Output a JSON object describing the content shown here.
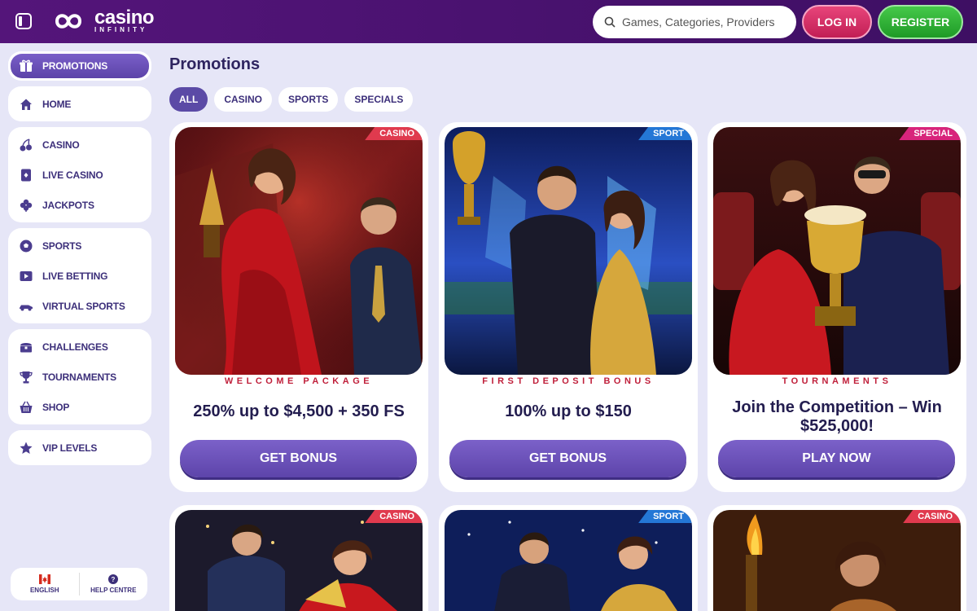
{
  "header": {
    "logo_big": "casino",
    "logo_small": "INFINITY",
    "search_placeholder": "Games, Categories, Providers",
    "login_label": "LOG IN",
    "register_label": "REGISTER"
  },
  "sidebar": {
    "groups": [
      [
        {
          "label": "PROMOTIONS",
          "icon": "gift-icon",
          "active": true
        }
      ],
      [
        {
          "label": "HOME",
          "icon": "home-icon"
        }
      ],
      [
        {
          "label": "CASINO",
          "icon": "cherries-icon"
        },
        {
          "label": "LIVE CASINO",
          "icon": "live-card-icon"
        },
        {
          "label": "JACKPOTS",
          "icon": "clover-icon"
        }
      ],
      [
        {
          "label": "SPORTS",
          "icon": "soccer-ball-icon"
        },
        {
          "label": "LIVE BETTING",
          "icon": "play-screen-icon"
        },
        {
          "label": "VIRTUAL SPORTS",
          "icon": "race-car-icon"
        }
      ],
      [
        {
          "label": "CHALLENGES",
          "icon": "treasure-chest-icon"
        },
        {
          "label": "TOURNAMENTS",
          "icon": "trophy-icon"
        },
        {
          "label": "SHOP",
          "icon": "basket-icon"
        }
      ],
      [
        {
          "label": "VIP LEVELS",
          "icon": "star-icon"
        }
      ]
    ],
    "footer": {
      "language": "ENGLISH",
      "help": "HELP CENTRE"
    }
  },
  "main": {
    "title": "Promotions",
    "filters": [
      "ALL",
      "CASINO",
      "SPORTS",
      "SPECIALS"
    ],
    "active_filter": "ALL",
    "cards": [
      {
        "tag": "CASINO",
        "tag_type": "casino",
        "subtitle": "WELCOME PACKAGE",
        "title": "250% up to $4,500 + 350 FS",
        "button": "GET BONUS",
        "scene": "red"
      },
      {
        "tag": "SPORT",
        "tag_type": "sport",
        "subtitle": "FIRST DEPOSIT BONUS",
        "title": "100% up to $150",
        "button": "GET BONUS",
        "scene": "blue"
      },
      {
        "tag": "SPECIAL",
        "tag_type": "special",
        "subtitle": "TOURNAMENTS",
        "title": "Join the Competition – Win $525,000!",
        "button": "PLAY NOW",
        "scene": "theater"
      },
      {
        "tag": "CASINO",
        "tag_type": "casino",
        "subtitle": "",
        "title": "",
        "button": "",
        "scene": "night"
      },
      {
        "tag": "SPORT",
        "tag_type": "sport",
        "subtitle": "",
        "title": "",
        "button": "",
        "scene": "space"
      },
      {
        "tag": "CASINO",
        "tag_type": "casino",
        "subtitle": "",
        "title": "",
        "button": "",
        "scene": "torch"
      }
    ]
  },
  "colors": {
    "header_bg": "#4a1270",
    "page_bg": "#e6e6f7",
    "accent_purple": "#5b4aa6",
    "login_pink": "#d6336a",
    "register_green": "#2eb335",
    "subtitle_red": "#c0203b"
  }
}
